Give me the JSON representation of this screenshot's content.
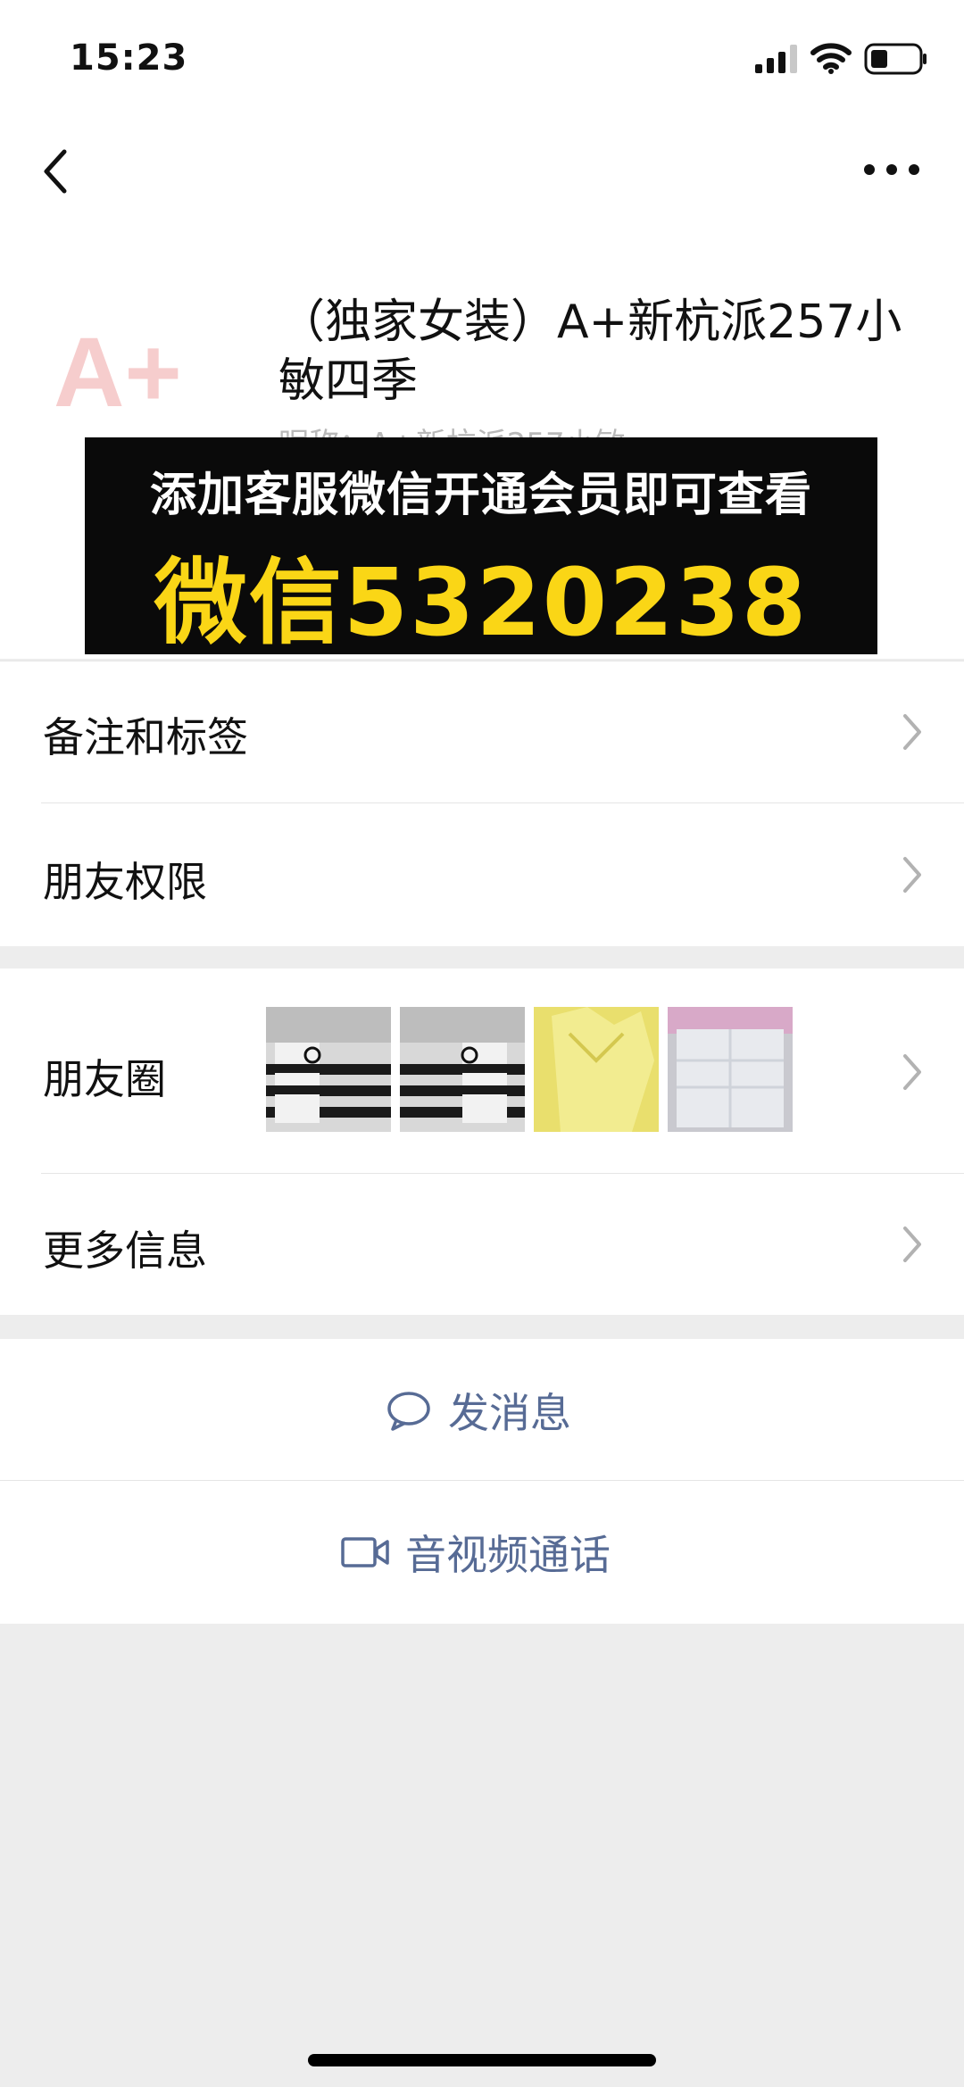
{
  "status_bar": {
    "time": "15:23"
  },
  "profile": {
    "avatar_text": "A+",
    "name": "（独家女装）A+新杭派257小敏四季",
    "sub_text": "昵称：A+新杭派257小敏"
  },
  "banner": {
    "line1": "添加客服微信开通会员即可查看",
    "line2": "微信5320238"
  },
  "cells": {
    "remark_label": "备注和标签",
    "permission_label": "朋友权限",
    "moments_label": "朋友圈",
    "more_label": "更多信息"
  },
  "actions": {
    "message_label": "发消息",
    "call_label": "音视频通话"
  },
  "colors": {
    "link": "#576b95",
    "banner_yellow": "#fad616",
    "background": "#ededed"
  }
}
